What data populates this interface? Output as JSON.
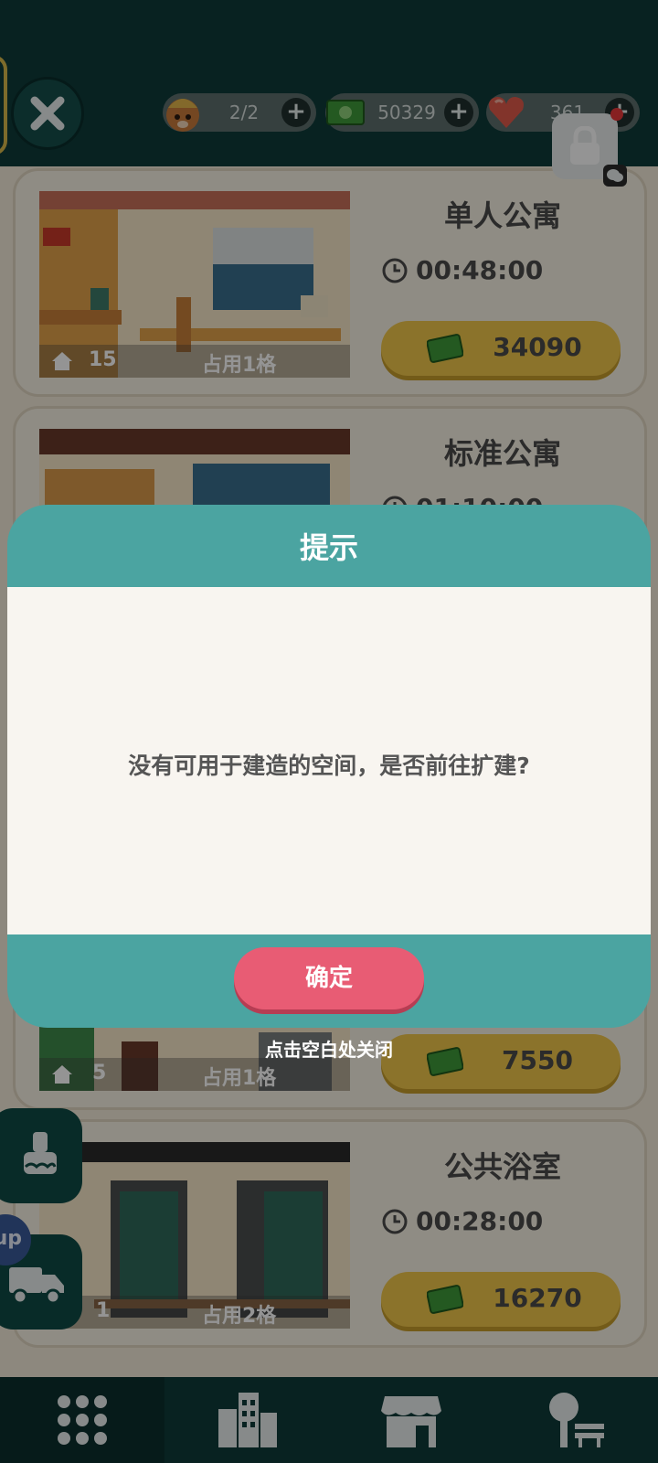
{
  "header": {
    "resources": [
      {
        "icon": "cat-worker-icon",
        "value": "2/2"
      },
      {
        "icon": "cash-icon",
        "value": "50329"
      },
      {
        "icon": "heart-gem-icon",
        "value": "361"
      }
    ]
  },
  "apartments": [
    {
      "title": "单人公寓",
      "time": "00:48:00",
      "price": "34090",
      "count": "15",
      "occupy": "占用1格"
    },
    {
      "title": "标准公寓",
      "time": "01:10:00",
      "price": "",
      "count": "",
      "occupy": ""
    },
    {
      "title": "",
      "time": "",
      "price": "7550",
      "count": "5",
      "occupy": "占用1格"
    },
    {
      "title": "公共浴室",
      "time": "00:28:00",
      "price": "16270",
      "count": "1",
      "occupy": "占用2格"
    }
  ],
  "side": {
    "up_label": "up"
  },
  "dialog": {
    "title": "提示",
    "message": "没有可用于建造的空间，是否前往扩建?",
    "confirm_label": "确定",
    "dismiss_hint": "点击空白处关闭"
  },
  "colors": {
    "header_bg": "#0f3c3a",
    "dialog_teal": "#4ba4a1",
    "confirm_pink": "#e85c74",
    "price_yellow": "#f0c64a"
  }
}
